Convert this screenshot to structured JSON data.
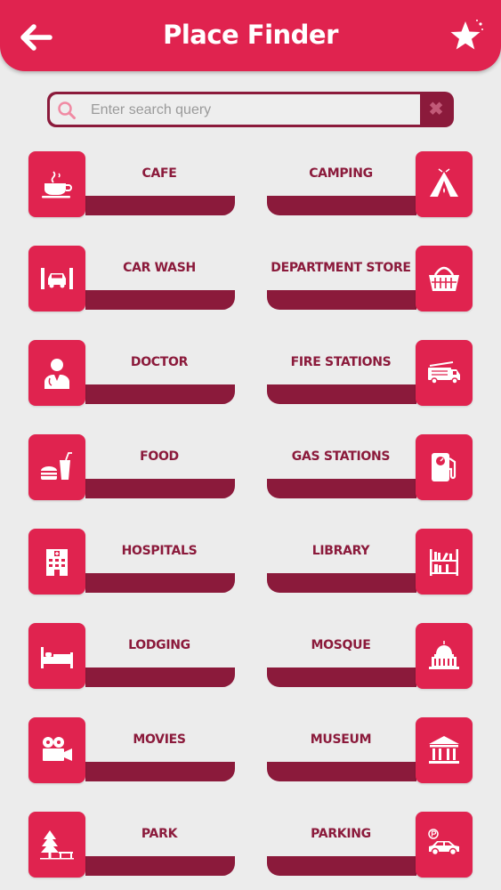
{
  "header": {
    "title": "Place Finder"
  },
  "search": {
    "placeholder": "Enter search query",
    "value": "",
    "clear_glyph": "✖"
  },
  "colors": {
    "accent": "#e0234f",
    "dark": "#8b1a3b",
    "background": "#ececec"
  },
  "categories": [
    {
      "label": "CAFE",
      "icon": "coffee-cup-icon"
    },
    {
      "label": "CAMPING",
      "icon": "tent-icon"
    },
    {
      "label": "CAR WASH",
      "icon": "car-wash-icon"
    },
    {
      "label": "DEPARTMENT STORE",
      "icon": "basket-icon"
    },
    {
      "label": "DOCTOR",
      "icon": "doctor-icon"
    },
    {
      "label": "FIRE STATIONS",
      "icon": "fire-truck-icon"
    },
    {
      "label": "FOOD",
      "icon": "burger-drink-icon"
    },
    {
      "label": "GAS STATIONS",
      "icon": "fuel-pump-icon"
    },
    {
      "label": "HOSPITALS",
      "icon": "hospital-building-icon"
    },
    {
      "label": "LIBRARY",
      "icon": "bookshelf-icon"
    },
    {
      "label": "LODGING",
      "icon": "bed-icon"
    },
    {
      "label": "MOSQUE",
      "icon": "dome-building-icon"
    },
    {
      "label": "MOVIES",
      "icon": "film-camera-icon"
    },
    {
      "label": "MUSEUM",
      "icon": "museum-columns-icon"
    },
    {
      "label": "PARK",
      "icon": "tree-bench-icon"
    },
    {
      "label": "PARKING",
      "icon": "parked-car-icon"
    }
  ]
}
